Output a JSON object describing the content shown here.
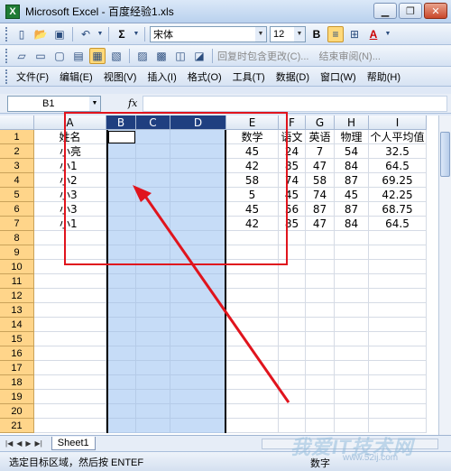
{
  "window": {
    "title": "Microsoft Excel - 百度经验1.xls",
    "app_icon": "excel-icon",
    "controls": [
      "minimize",
      "restore",
      "close"
    ]
  },
  "toolbar_standard": {
    "icons": [
      "new-icon",
      "open-icon",
      "save-icon",
      "undo-icon",
      "sum-icon"
    ],
    "sum_label": "Σ",
    "font_name": "宋体",
    "font_size": "12",
    "bold": "B",
    "align_active": "center",
    "font_color_label": "A"
  },
  "toolbar_review": {
    "reply_with_changes": "回复时包含更改(C)...",
    "end_review": "结束审阅(N)..."
  },
  "menu": {
    "items": [
      "文件(F)",
      "编辑(E)",
      "视图(V)",
      "插入(I)",
      "格式(O)",
      "工具(T)",
      "数据(D)",
      "窗口(W)",
      "帮助(H)"
    ]
  },
  "formula_bar": {
    "name_box": "B1",
    "fx": "fx",
    "value": ""
  },
  "sheet": {
    "columns": [
      "A",
      "B",
      "C",
      "D",
      "E",
      "F",
      "G",
      "H",
      "I"
    ],
    "selected_columns": [
      "B",
      "C",
      "D"
    ],
    "row_numbers": [
      "1",
      "2",
      "3",
      "4",
      "5",
      "6",
      "7",
      "8",
      "9",
      "10",
      "11",
      "12",
      "13",
      "14",
      "15",
      "16",
      "17",
      "18",
      "19",
      "20",
      "21"
    ],
    "rows": [
      [
        "姓名",
        "",
        "",
        "",
        "数学",
        "语文",
        "英语",
        "物理",
        "个人平均值"
      ],
      [
        "小亮",
        "",
        "",
        "",
        "45",
        "24",
        "7",
        "54",
        "32.5"
      ],
      [
        "小1",
        "",
        "",
        "",
        "42",
        "85",
        "47",
        "84",
        "64.5"
      ],
      [
        "小2",
        "",
        "",
        "",
        "58",
        "74",
        "58",
        "87",
        "69.25"
      ],
      [
        "小3",
        "",
        "",
        "",
        "5",
        "45",
        "74",
        "45",
        "42.25"
      ],
      [
        "小3",
        "",
        "",
        "",
        "45",
        "56",
        "87",
        "87",
        "68.75"
      ],
      [
        "小1",
        "",
        "",
        "",
        "42",
        "85",
        "47",
        "84",
        "64.5"
      ]
    ]
  },
  "sheet_tabs": [
    "Sheet1"
  ],
  "status": {
    "message": "选定目标区域，然后按 ENTEF",
    "mode": "数字"
  },
  "watermark": {
    "text": "我爱IT技术网",
    "sub": "www.52ij.com"
  },
  "annotation_color": "#e0141d"
}
